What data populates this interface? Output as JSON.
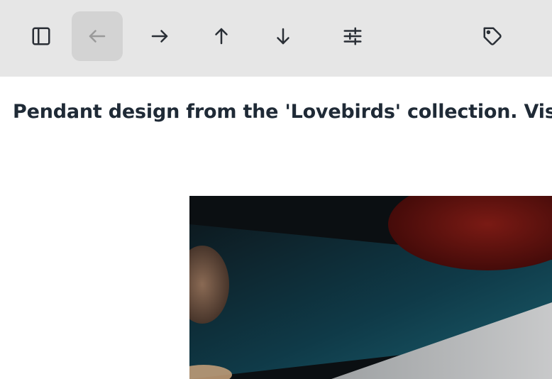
{
  "toolbar": {
    "buttons": [
      {
        "name": "sidebar-toggle",
        "icon": "sidebar-icon",
        "active": false
      },
      {
        "name": "back",
        "icon": "arrow-left-icon",
        "active": true
      },
      {
        "name": "forward",
        "icon": "arrow-right-icon",
        "active": false
      },
      {
        "name": "up",
        "icon": "arrow-up-icon",
        "active": false
      },
      {
        "name": "down",
        "icon": "arrow-down-icon",
        "active": false
      },
      {
        "name": "filters",
        "icon": "sliders-icon",
        "active": false
      },
      {
        "name": "tag",
        "icon": "tag-icon",
        "active": false
      }
    ],
    "colors": {
      "background": "#e6e6e6",
      "active_background": "#d3d3d3",
      "icon": "#2a2f36",
      "icon_disabled": "#9a9a9a"
    }
  },
  "content": {
    "caption": "Pendant design from the 'Lovebirds' collection. Visit prof",
    "image": {
      "alt": "product photo"
    }
  }
}
